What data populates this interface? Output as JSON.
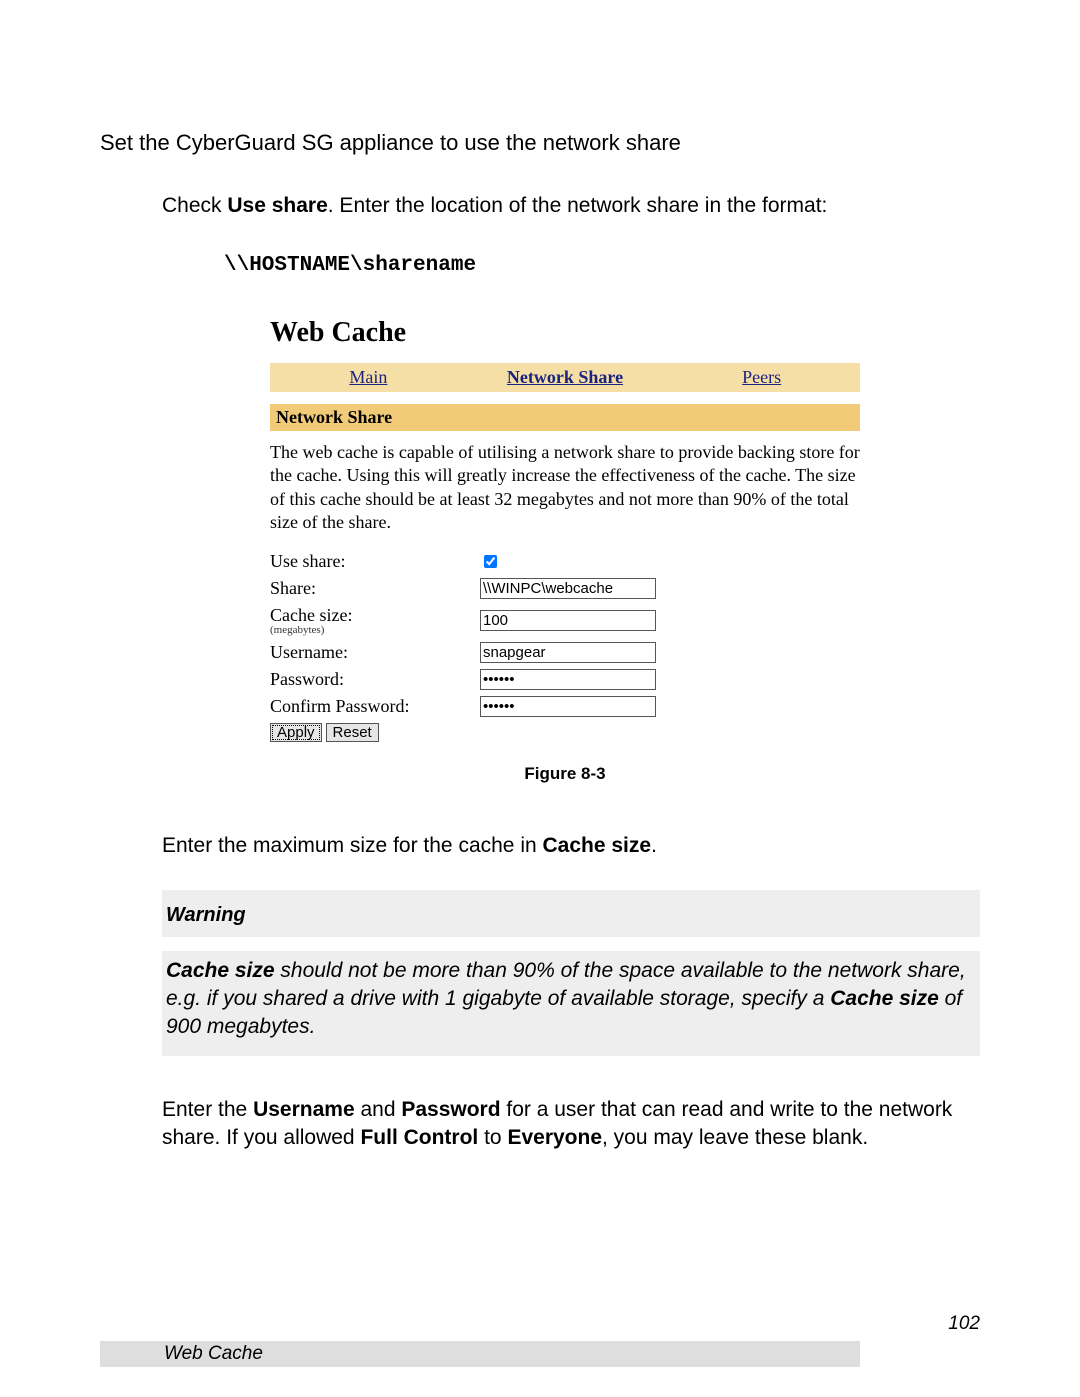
{
  "intro": {
    "title": "Set the CyberGuard SG appliance to use the network share",
    "sub_prefix": "Check ",
    "sub_bold": "Use share",
    "sub_suffix": ".  Enter the location of the network share in the format:",
    "sharename": "\\\\HOSTNAME\\sharename"
  },
  "shot": {
    "title": "Web Cache",
    "tabs": {
      "main": "Main",
      "network_share": "Network Share",
      "peers": "Peers"
    },
    "section_header": "Network Share",
    "description": "The web cache is capable of utilising a network share to provide backing store for the cache. Using this will greatly increase the effectiveness of the cache. The size of this cache should be at least 32 megabytes and not more than 90% of the total size of the share.",
    "labels": {
      "use_share": "Use share:",
      "share": "Share:",
      "cache_size": "Cache size:",
      "cache_size_sub": "(megabytes)",
      "username": "Username:",
      "password": "Password:",
      "confirm_password": "Confirm Password:"
    },
    "values": {
      "use_share_checked": true,
      "share": "\\\\WINPC\\webcache",
      "cache_size": "100",
      "username": "snapgear",
      "password": "••••••",
      "confirm_password": "••••••"
    },
    "buttons": {
      "apply": "Apply",
      "reset": "Reset"
    }
  },
  "figure_caption": "Figure 8-3",
  "after_figure": {
    "prefix": "Enter the maximum size for the cache in ",
    "bold": "Cache size",
    "suffix": "."
  },
  "warning": {
    "title": "Warning",
    "bold1": "Cache size",
    "text1": " should not be more than 90% of the space available to the network share, e.g. if you shared a drive with 1 gigabyte of available storage, specify a ",
    "bold2": "Cache size",
    "text2": " of 900 megabytes."
  },
  "creds_para": {
    "p1": "Enter the ",
    "b1": "Username",
    "p2": " and ",
    "b2": "Password",
    "p3": " for a user that can read and write to the network share.  If you allowed ",
    "b3": "Full Control",
    "p4": " to ",
    "b4": "Everyone",
    "p5": ", you may leave these blank."
  },
  "footer": {
    "label": "Web Cache",
    "page_num": "102"
  }
}
